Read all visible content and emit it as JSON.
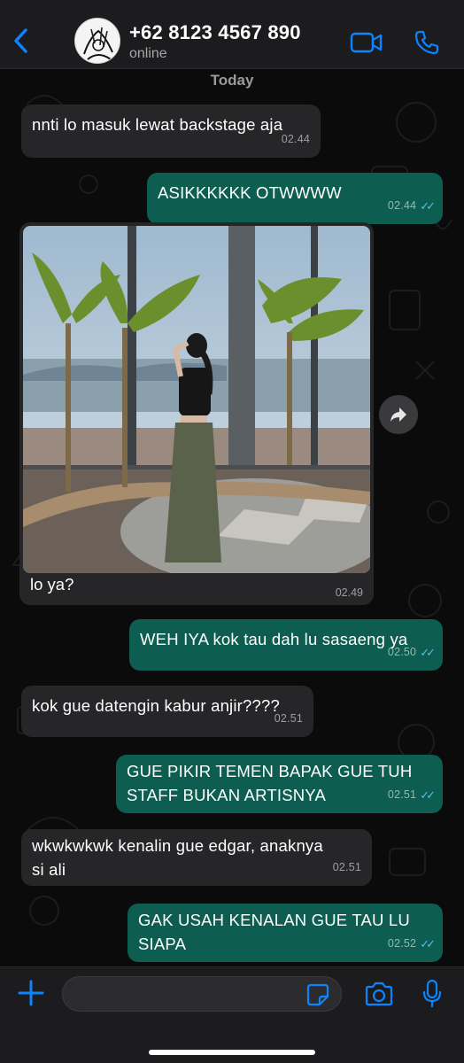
{
  "header": {
    "contact_name": "+62 8123 4567 890",
    "status": "online",
    "icons": [
      "chevron-left-icon",
      "video-call-icon",
      "phone-call-icon"
    ]
  },
  "chat": {
    "date_label": "Today",
    "messages": [
      {
        "dir": "in",
        "text": "nnti lo masuk lewat backstage aja",
        "time": "02.44"
      },
      {
        "dir": "out",
        "text": "ASIKKKKKK OTWWWW",
        "time": "02.44"
      },
      {
        "dir": "in",
        "type": "image",
        "caption": "lo ya?",
        "time": "02.49"
      },
      {
        "dir": "out",
        "text": "WEH IYA kok tau dah lu sasaeng ya",
        "time": "02.50"
      },
      {
        "dir": "in",
        "text": "kok gue datengin kabur anjir????",
        "time": "02.51"
      },
      {
        "dir": "out",
        "text_lines": [
          "GUE PIKIR TEMEN BAPAK GUE TUH",
          "STAFF BUKAN ARTISNYA"
        ],
        "time": "02.51"
      },
      {
        "dir": "in",
        "text_lines": [
          "wkwkwkwk kenalin gue edgar, anaknya",
          "si ali"
        ],
        "time": "02.51"
      },
      {
        "dir": "out",
        "text_lines": [
          "GAK USAH KENALAN GUE TAU LU",
          "SIAPA"
        ],
        "time": "02.52"
      }
    ]
  },
  "input": {
    "placeholder": "",
    "icons": [
      "plus-icon",
      "sticker-icon",
      "camera-icon",
      "microphone-icon"
    ]
  },
  "colors": {
    "accent": "#0a84ff",
    "outgoing_bubble": "#0d5e50",
    "incoming_bubble": "#262628",
    "read_ticks": "#53bdeb"
  }
}
